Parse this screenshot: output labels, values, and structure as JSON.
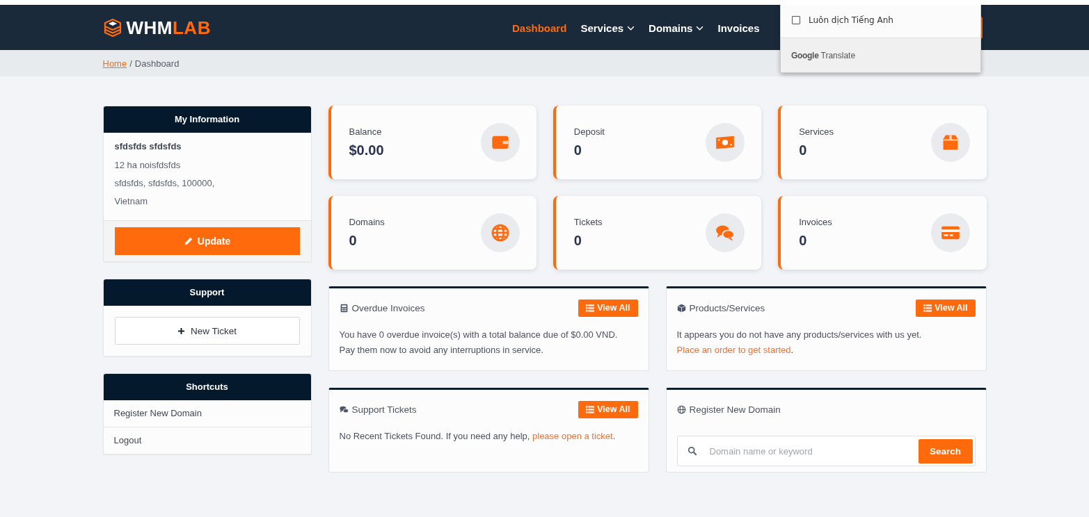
{
  "header": {
    "logo": {
      "part_1": "WHM",
      "part_2": "LAB"
    },
    "nav": [
      {
        "label": "Dashboard",
        "selected": true,
        "dropdown": false
      },
      {
        "label": "Services",
        "selected": false,
        "dropdown": true
      },
      {
        "label": "Domains",
        "selected": false,
        "dropdown": true
      },
      {
        "label": "Invoices",
        "selected": false,
        "dropdown": false
      }
    ]
  },
  "translate_popup": {
    "checkbox_label": "Luôn dịch Tiếng Anh",
    "checked": false,
    "brand": "Google",
    "product": "Translate"
  },
  "breadcrumb": {
    "link": "Home",
    "separator": "/",
    "current": "Dashboard"
  },
  "my_information": {
    "title": "My Information",
    "name": "sfdsfds sfdsfds",
    "address_lines": [
      "12 ha noisfdsfds",
      "sfdsfds, sfdsfds, 100000,",
      "Vietnam"
    ],
    "button": "Update"
  },
  "support": {
    "title": "Support",
    "button": "New Ticket"
  },
  "shortcuts": {
    "title": "Shortcuts",
    "items": [
      "Register New Domain",
      "Logout"
    ]
  },
  "stats": [
    {
      "label": "Balance",
      "value": "$0.00"
    },
    {
      "label": "Deposit",
      "value": "0"
    },
    {
      "label": "Services",
      "value": "0"
    },
    {
      "label": "Domains",
      "value": "0"
    },
    {
      "label": "Tickets",
      "value": "0"
    },
    {
      "label": "Invoices",
      "value": "0"
    }
  ],
  "panels": [
    {
      "kind": "text",
      "title": "Overdue Invoices",
      "button": "View All",
      "lines": [
        {
          "text": "You have 0 overdue invoice(s) with a total balance due of $0.00 VND. Pay them now to avoid any interruptions in service."
        }
      ]
    },
    {
      "kind": "text",
      "title": "Products/Services",
      "button": "View All",
      "lines": [
        {
          "text": "It appears you do not have any products/services with us yet."
        },
        {
          "link": "Place an order to get started",
          "after": "."
        }
      ]
    },
    {
      "kind": "text",
      "title": "Support Tickets",
      "button": "View All",
      "lines": [
        {
          "text": "No Recent Tickets Found. If you need any help,",
          "link": "please open a ticket",
          "after": "."
        }
      ]
    },
    {
      "kind": "search",
      "title": "Register New Domain",
      "placeholder": "Domain name or keyword",
      "button": "Search"
    }
  ]
}
